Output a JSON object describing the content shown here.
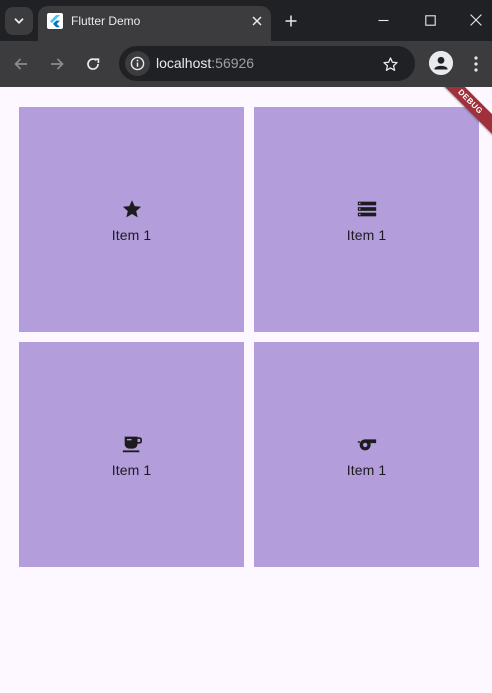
{
  "browser": {
    "tab_title": "Flutter Demo",
    "url_host": "localhost",
    "url_port": ":56926"
  },
  "app": {
    "debug_banner": "DEBUG",
    "accent": "#b39ddb",
    "background": "#fdf7ff",
    "cards": [
      {
        "icon": "star-icon",
        "label": "Item 1"
      },
      {
        "icon": "storage-icon",
        "label": "Item 1"
      },
      {
        "icon": "coffee-cup-icon",
        "label": "Item 1"
      },
      {
        "icon": "whistle-icon",
        "label": "Item 1"
      }
    ]
  }
}
